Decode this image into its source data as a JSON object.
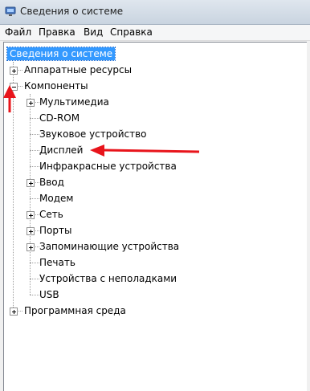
{
  "window": {
    "title": "Сведения о системе"
  },
  "menu": [
    "Файл",
    "Правка",
    "Вид",
    "Справка"
  ],
  "tree": {
    "root": "Сведения о системе",
    "hardware": "Аппаратные ресурсы",
    "components": "Компоненты",
    "children": [
      "Мультимедиа",
      "CD-ROM",
      "Звуковое устройство",
      "Дисплей",
      "Инфракрасные устройства",
      "Ввод",
      "Модем",
      "Сеть",
      "Порты",
      "Запоминающие устройства",
      "Печать",
      "Устройства с неполадками",
      "USB"
    ],
    "software": "Программная среда"
  },
  "colors": {
    "selection": "#3399ff",
    "annotation_arrow": "#e8141b"
  }
}
